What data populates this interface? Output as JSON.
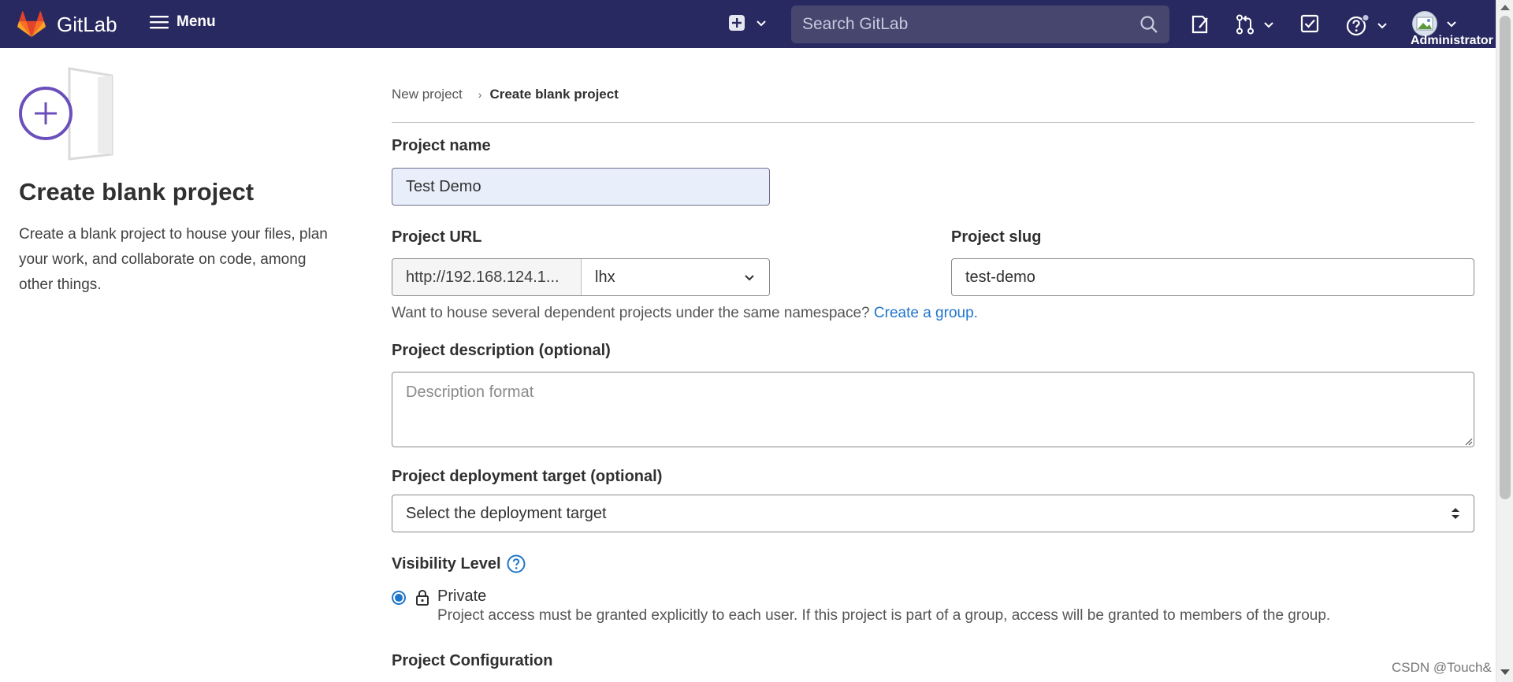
{
  "topbar": {
    "brand": "GitLab",
    "menu_label": "Menu",
    "search_placeholder": "Search GitLab",
    "user_label": "Administrator"
  },
  "left_panel": {
    "title": "Create blank project",
    "description": "Create a blank project to house your files, plan your work, and collaborate on code, among other things."
  },
  "breadcrumb": {
    "items": [
      "New project",
      "Create blank project"
    ]
  },
  "form": {
    "project_name": {
      "label": "Project name",
      "value": "Test Demo"
    },
    "project_url": {
      "label": "Project URL",
      "prefix": "http://192.168.124.1...",
      "namespace": "lhx"
    },
    "project_slug": {
      "label": "Project slug",
      "value": "test-demo"
    },
    "namespace_help": {
      "text": "Want to house several dependent projects under the same namespace?",
      "link": "Create a group."
    },
    "description": {
      "label": "Project description (optional)",
      "placeholder": "Description format"
    },
    "deployment_target": {
      "label": "Project deployment target (optional)",
      "selected": "Select the deployment target"
    },
    "visibility": {
      "label": "Visibility Level",
      "option_title": "Private",
      "option_desc": "Project access must be granted explicitly to each user. If this project is part of a group, access will be granted to members of the group."
    },
    "configuration": {
      "label": "Project Configuration"
    }
  },
  "watermark": "CSDN @Touch&",
  "colors": {
    "topbar": "#292961",
    "link": "#1f75cb",
    "accent_purple": "#6b4fbb"
  }
}
